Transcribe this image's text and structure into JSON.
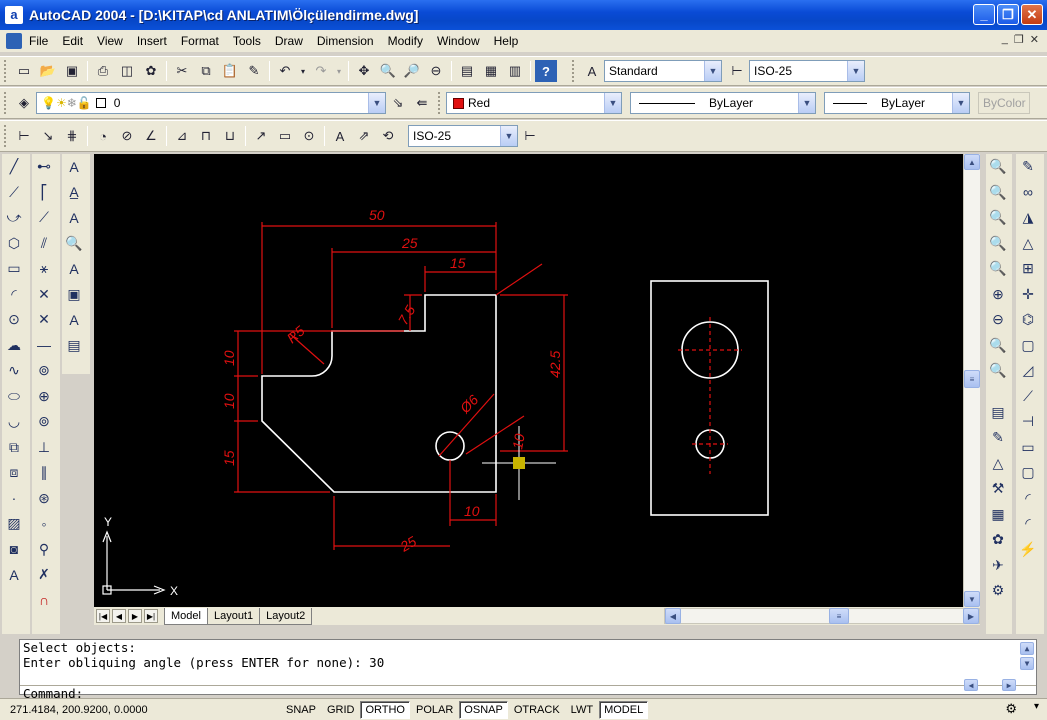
{
  "window": {
    "title": "AutoCAD 2004 - [D:\\KITAP\\cd ANLATIM\\Ölçülendirme.dwg]",
    "app_icon": "a"
  },
  "menu": [
    "File",
    "Edit",
    "View",
    "Insert",
    "Format",
    "Tools",
    "Draw",
    "Dimension",
    "Modify",
    "Window",
    "Help"
  ],
  "toolbars": {
    "text_style": "Standard",
    "dim_style": "ISO-25",
    "layer": "0",
    "color": "Red",
    "linetype": "ByLayer",
    "lineweight": "ByLayer",
    "plotstyle": "ByColor",
    "dim_toolbar_style": "ISO-25"
  },
  "drawing": {
    "dim_50": "50",
    "dim_25": "25",
    "dim_15_top": "15",
    "dim_7_5": "7.5",
    "dim_r5": "R5",
    "dim_10_a": "10",
    "dim_10_b": "10",
    "dim_15_left": "15",
    "dim_42_5": "42.5",
    "dim_d6": "Ø6",
    "dim_10_right": "10",
    "dim_10_bottom": "10",
    "dim_25_bottom": "25",
    "ucs_x": "X",
    "ucs_y": "Y"
  },
  "tabs": [
    "Model",
    "Layout1",
    "Layout2"
  ],
  "command": {
    "line1": "Select objects:",
    "line2": "Enter obliquing angle (press ENTER for none): 30",
    "prompt": "Command:"
  },
  "status": {
    "coords": "271.4184, 200.9200, 0.0000",
    "buttons": [
      "SNAP",
      "GRID",
      "ORTHO",
      "POLAR",
      "OSNAP",
      "OTRACK",
      "LWT",
      "MODEL"
    ],
    "active": [
      "ORTHO",
      "OSNAP",
      "MODEL"
    ]
  },
  "colors": {
    "dimension": "#e01010",
    "geometry": "#ffffff",
    "canvas": "#000000"
  }
}
